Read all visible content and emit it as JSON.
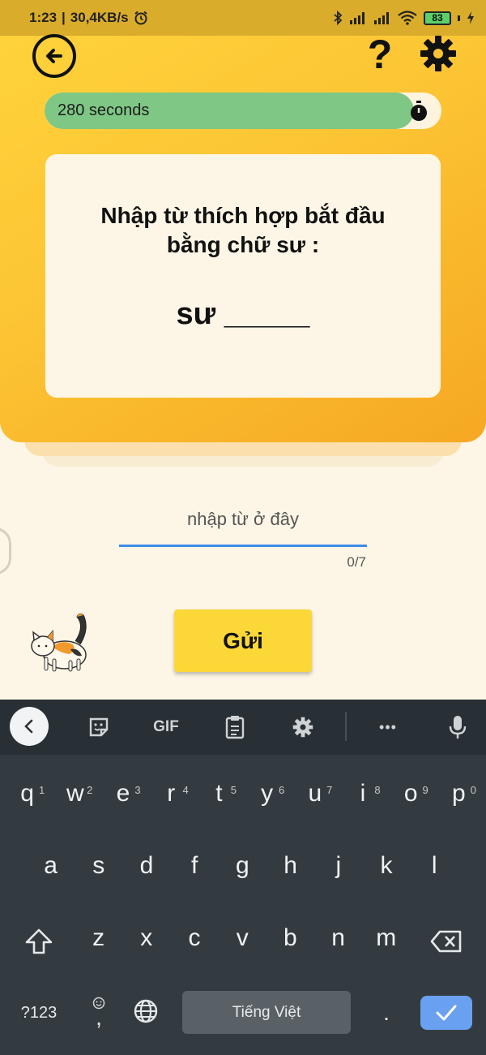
{
  "status_bar": {
    "time": "1:23",
    "network_speed": "30,4KB/s",
    "battery_level": "83",
    "icons": [
      "alarm-icon",
      "bluetooth-icon",
      "signal-icon",
      "signal-icon",
      "wifi-icon",
      "battery-icon",
      "charging-icon"
    ]
  },
  "header": {
    "back_icon": "back-arrow-icon",
    "help_label": "?",
    "settings_icon": "gear-icon"
  },
  "timer": {
    "label": "280 seconds",
    "remaining_fraction": 0.93,
    "icon": "stopwatch-icon",
    "fill_color": "#7fc785"
  },
  "question": {
    "prompt": "Nhập từ thích hợp bắt đầu bằng chữ sư :",
    "word": "sư _____"
  },
  "answer": {
    "placeholder": "nhập từ ở đây",
    "value": "",
    "counter": "0/7"
  },
  "submit_label": "Gửi",
  "keyboard": {
    "toolbar_gif": "GIF",
    "toolbar_more": "•••",
    "row1": [
      {
        "k": "q",
        "n": "1"
      },
      {
        "k": "w",
        "n": "2"
      },
      {
        "k": "e",
        "n": "3"
      },
      {
        "k": "r",
        "n": "4"
      },
      {
        "k": "t",
        "n": "5"
      },
      {
        "k": "y",
        "n": "6"
      },
      {
        "k": "u",
        "n": "7"
      },
      {
        "k": "i",
        "n": "8"
      },
      {
        "k": "o",
        "n": "9"
      },
      {
        "k": "p",
        "n": "0"
      }
    ],
    "row2": [
      "a",
      "s",
      "d",
      "f",
      "g",
      "h",
      "j",
      "k",
      "l"
    ],
    "row3": [
      "z",
      "x",
      "c",
      "v",
      "b",
      "n",
      "m"
    ],
    "symbols_label": "?123",
    "comma_label": ",",
    "space_label": "Tiếng Việt",
    "period_label": "."
  },
  "colors": {
    "accent_yellow": "#fcd738",
    "input_underline": "#3d8be8",
    "enter_key": "#6aa0f0"
  }
}
